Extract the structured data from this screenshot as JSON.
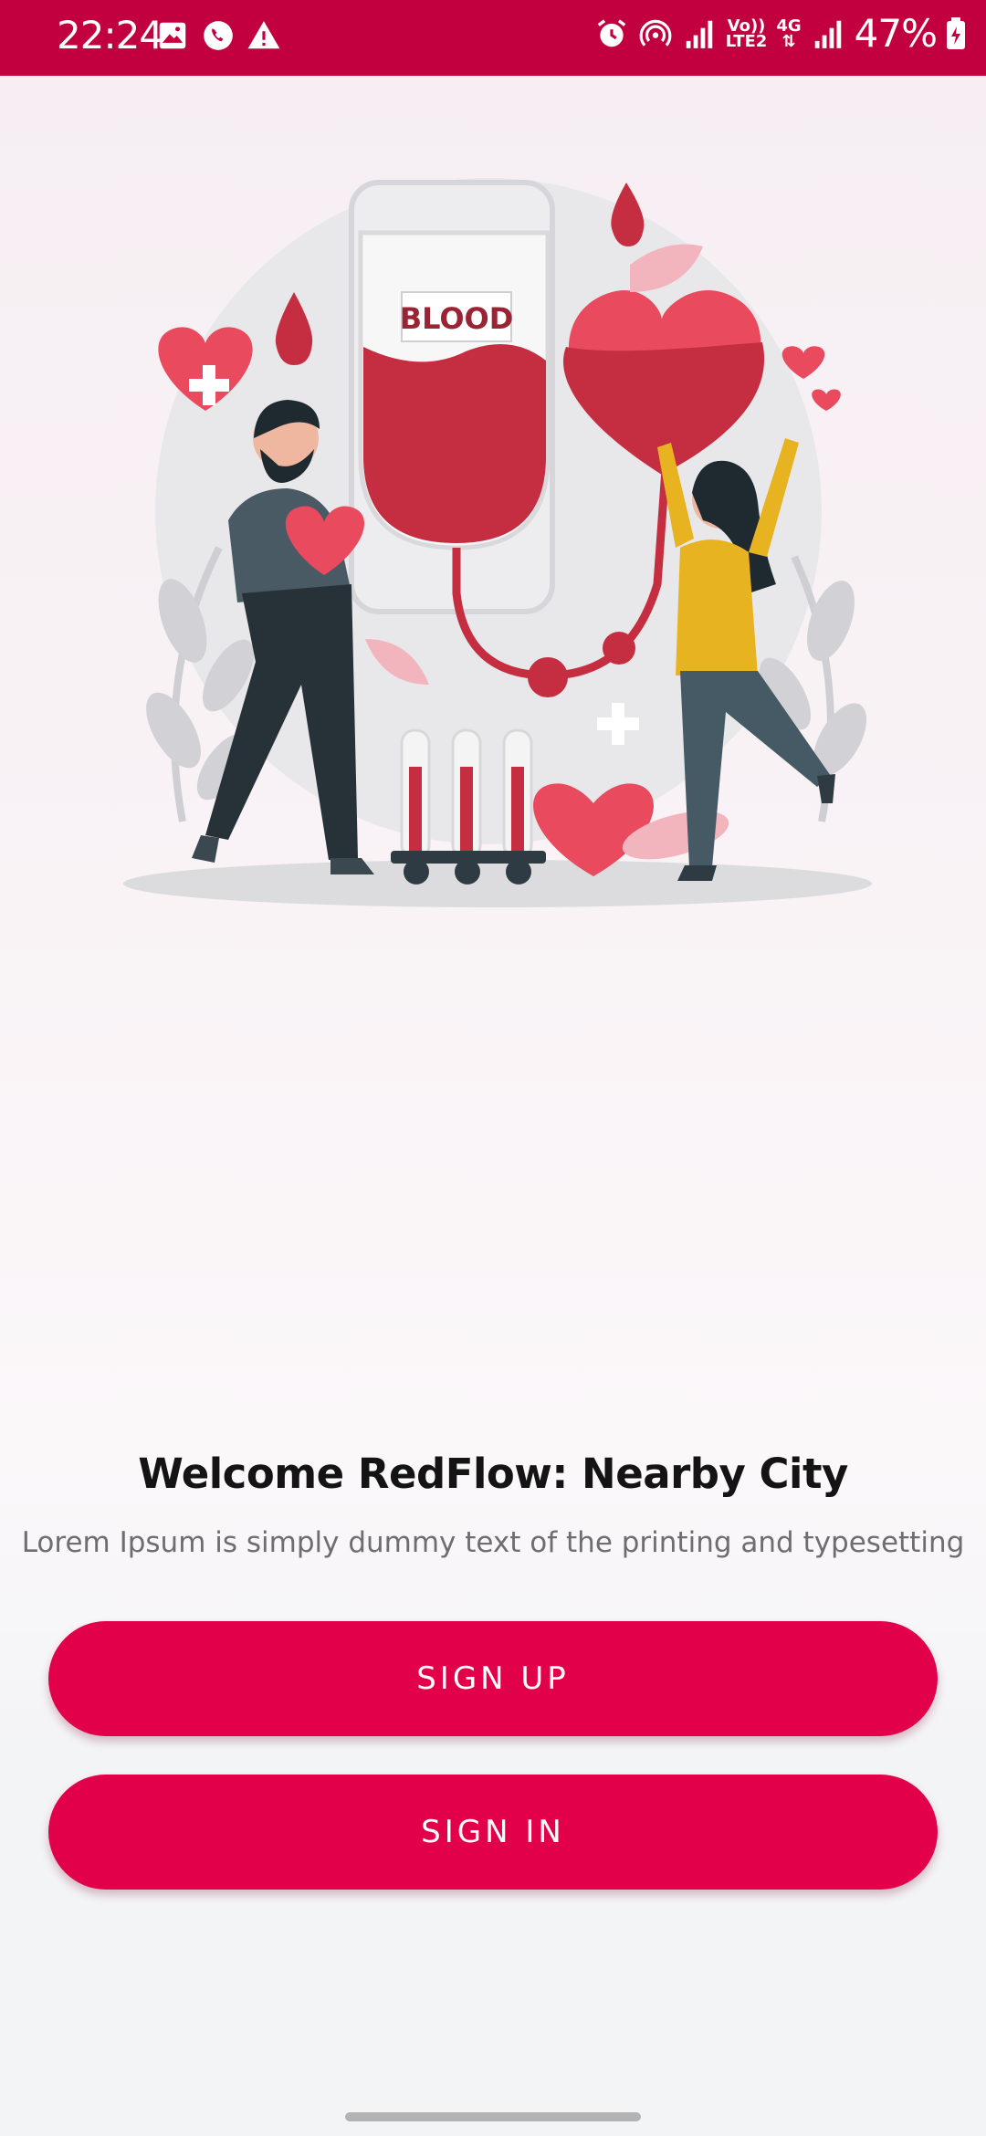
{
  "status_bar": {
    "time": "22:24",
    "network_top": "Vo))",
    "network_bottom": "LTE2",
    "network_gen": "4G",
    "battery": "47%",
    "icons": [
      "gallery-icon",
      "call-icon",
      "warning-icon",
      "alarm-icon",
      "hotspot-icon",
      "signal-icon",
      "signal-icon",
      "battery-charging-icon"
    ]
  },
  "illustration": {
    "bag_label": "BLOOD",
    "icon": "blood-donation-illustration"
  },
  "welcome": {
    "title": "Welcome RedFlow: Nearby City",
    "subtitle": "Lorem Ipsum is simply dummy text of the printing and typesetting"
  },
  "buttons": {
    "sign_up": "SIGN UP",
    "sign_in": "SIGN IN"
  },
  "colors": {
    "primary": "#e2004a",
    "status_bar": "#c2003f"
  }
}
